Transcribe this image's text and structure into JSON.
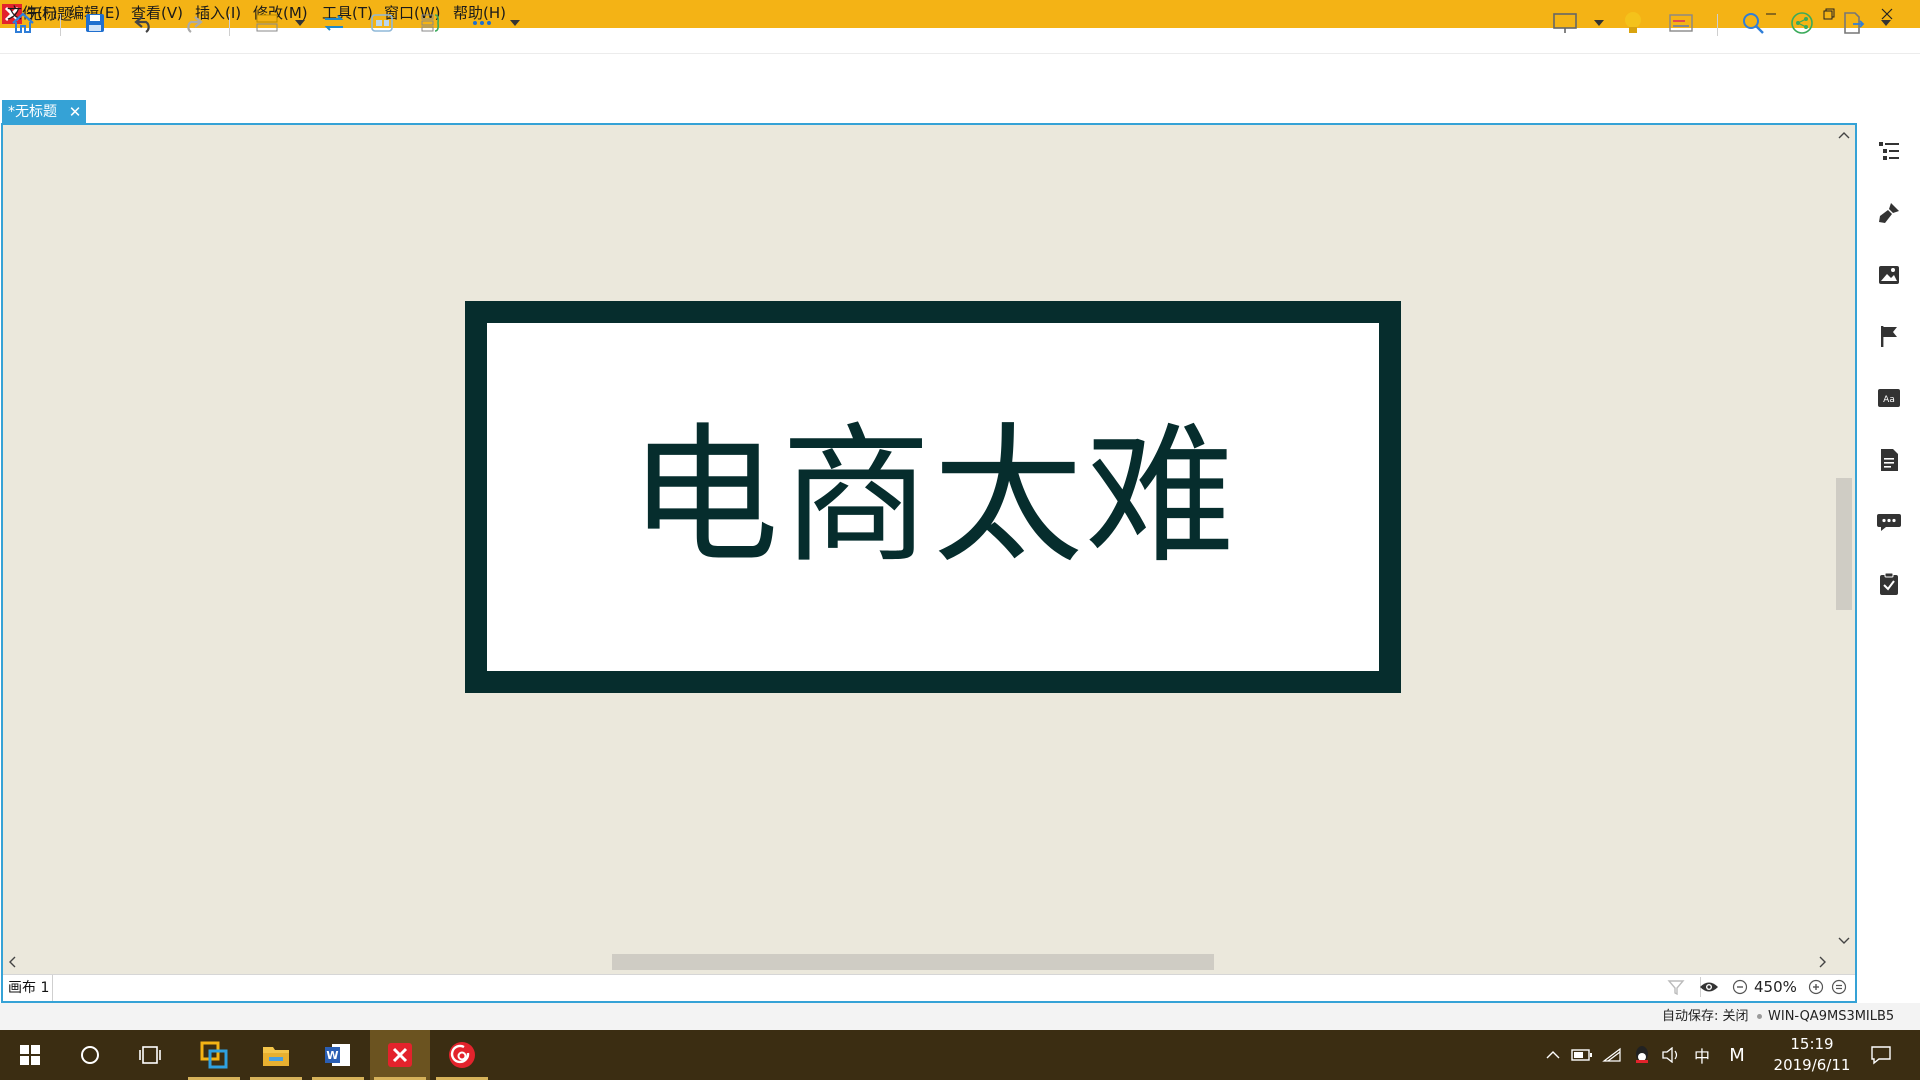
{
  "window": {
    "title": "无标题"
  },
  "menu": [
    "文件(F)",
    "编辑(E)",
    "查看(V)",
    "插入(I)",
    "修改(M)",
    "工具(T)",
    "窗口(W)",
    "帮助(H)"
  ],
  "tab": {
    "label": "*无标题",
    "close": "✕"
  },
  "topic": {
    "text": "电商太难"
  },
  "sheetbar": {
    "sheet": "画布 1",
    "zoom": "450%"
  },
  "status": {
    "autosave": "自动保存: 关闭",
    "machine": "WIN-QA9MS3MILB5"
  },
  "taskbar": {
    "ime": "中",
    "ime2": "M",
    "time": "15:19",
    "date": "2019/6/11"
  },
  "colors": {
    "accent": "#35a2d6",
    "titlebar": "#f4b315",
    "canvas": "#ebe8dc",
    "topic_border": "#062d2d"
  }
}
